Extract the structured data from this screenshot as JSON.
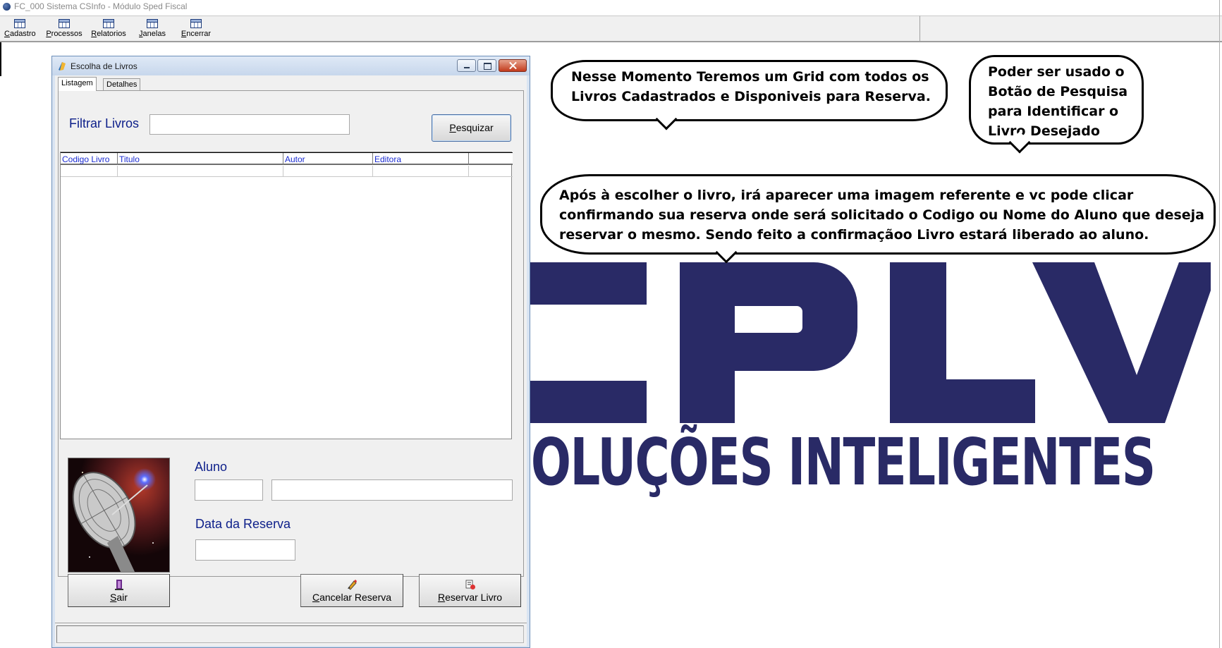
{
  "app": {
    "title": "FC_000   Sistema CSInfo - Módulo Sped Fiscal"
  },
  "toolbar": {
    "items": [
      {
        "label": "Cadastro",
        "icon": "table-icon"
      },
      {
        "label": "Processos",
        "icon": "table-icon"
      },
      {
        "label": "Relatorios",
        "icon": "table-icon"
      },
      {
        "label": "Janelas",
        "icon": "table-icon"
      },
      {
        "label": "Encerrar",
        "icon": "table-icon"
      }
    ]
  },
  "dialog": {
    "title": "Escolha de Livros",
    "tabs": [
      {
        "label": "Listagem"
      },
      {
        "label": "Detalhes"
      }
    ],
    "filter": {
      "label": "Filtrar Livros",
      "value": "",
      "search_button": "Pesquizar"
    },
    "grid": {
      "columns": [
        "Codigo Livro",
        "Titulo",
        "Autor",
        "Editora"
      ],
      "rows": []
    },
    "aluno": {
      "label": "Aluno",
      "code_value": "",
      "name_value": ""
    },
    "data_reserva": {
      "label": "Data da Reserva",
      "value": ""
    },
    "buttons": {
      "sair": "Sair",
      "cancelar": "Cancelar Reserva",
      "reservar": "Reservar Livro"
    }
  },
  "callouts": {
    "grid_note": "Nesse Momento Teremos um Grid com todos os Livros Cadastrados e Disponiveis para Reserva.",
    "search_note": "Poder ser usado o Botão de Pesquisa para Identificar o Livro Desejado",
    "reserve_note": "Após à escolher o livro, irá aparecer uma imagem referente e vc pode clicar confirmando sua reserva onde será solicitado o Codigo ou Nome do Aluno que deseja reservar o mesmo. Sendo feito a confirmaçãoo Livro estará liberado ao aluno."
  },
  "logo": {
    "wordmark": "CPLV",
    "tagline": "SOLUÇÕES INTELIGENTES",
    "color": "#292a66"
  },
  "colors": {
    "label_blue": "#0d1f8a",
    "grid_header_blue": "#1a2bd0",
    "window_frame": "#d9e4f2"
  }
}
